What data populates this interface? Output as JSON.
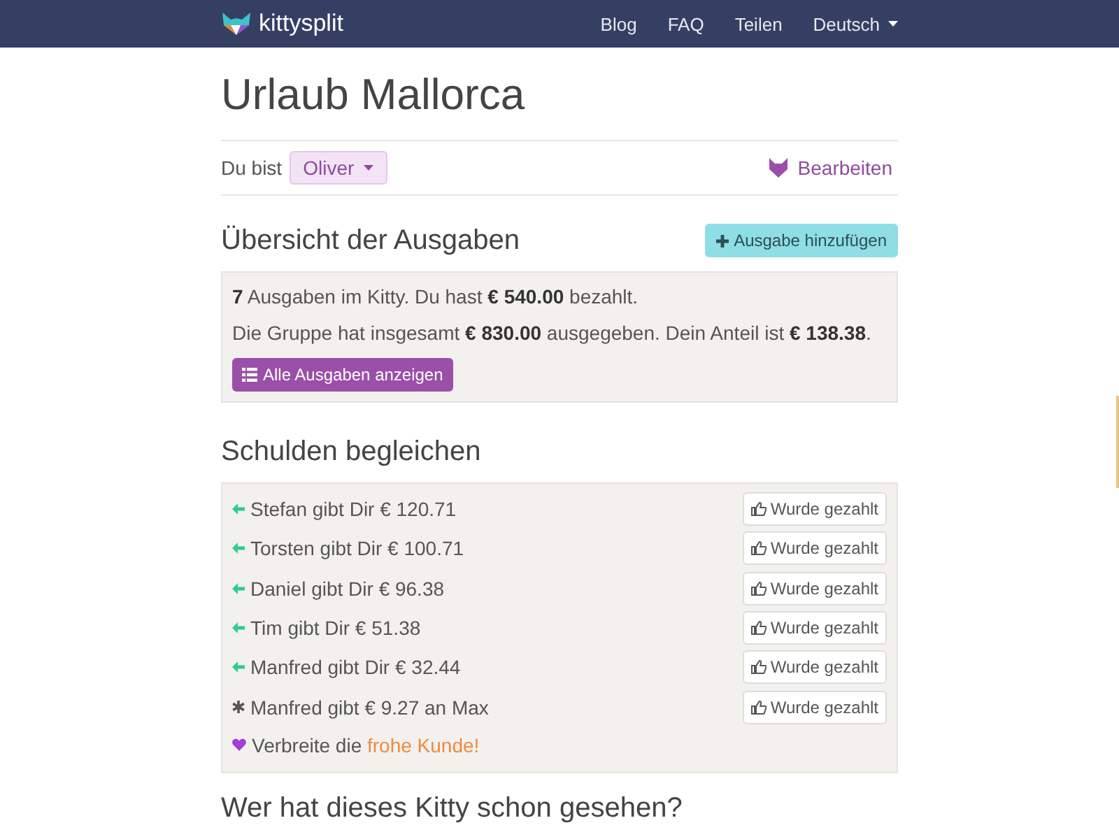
{
  "navbar": {
    "brand": "kittysplit",
    "links": [
      "Blog",
      "FAQ",
      "Teilen"
    ],
    "language": "Deutsch"
  },
  "title": "Urlaub Mallorca",
  "identity": {
    "label": "Du bist",
    "person": "Oliver",
    "edit": "Bearbeiten"
  },
  "overview": {
    "heading": "Übersicht der Ausgaben",
    "add_button": "Ausgabe hinzufügen",
    "lines": [
      "**7** Ausgaben im Kitty. Du hast **€ 540.00** bezahlt.",
      "Die Gruppe hat insgesamt **€ 830.00** ausgegeben. Dein Anteil ist **€ 138.38**."
    ],
    "show_all_button": "Alle Ausgaben anzeigen"
  },
  "debts": {
    "heading": "Schulden begleichen",
    "items": [
      {
        "kind": "to_you",
        "text": "Stefan gibt Dir € 120.71",
        "button": "Wurde gezahlt"
      },
      {
        "kind": "to_you",
        "text": "Torsten gibt Dir € 100.71",
        "button": "Wurde gezahlt"
      },
      {
        "kind": "to_you",
        "text": "Daniel gibt Dir € 96.38",
        "button": "Wurde gezahlt"
      },
      {
        "kind": "to_you",
        "text": "Tim gibt Dir € 51.38",
        "button": "Wurde gezahlt"
      },
      {
        "kind": "to_you",
        "text": "Manfred gibt Dir € 32.44",
        "button": "Wurde gezahlt"
      },
      {
        "kind": "between",
        "text": "Manfred gibt € 9.27 an Max",
        "button": "Wurde gezahlt"
      }
    ],
    "share": {
      "text": "Verbreite die ",
      "link": "frohe Kunde!"
    }
  },
  "seen_heading": "Wer hat dieses Kitty schon gesehen?"
}
